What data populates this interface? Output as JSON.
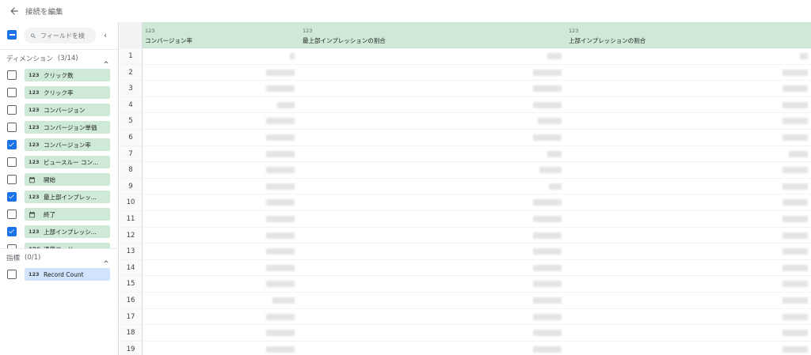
{
  "header": {
    "title": "接続を編集"
  },
  "search": {
    "placeholder": "フィールドを検"
  },
  "dimensions": {
    "title": "ディメンション",
    "count": "(3/14)",
    "fields": [
      {
        "type": "123",
        "label": "クリック数",
        "checked": false
      },
      {
        "type": "123",
        "label": "クリック率",
        "checked": false
      },
      {
        "type": "123",
        "label": "コンバージョン",
        "checked": false
      },
      {
        "type": "123",
        "label": "コンバージョン単価",
        "checked": false
      },
      {
        "type": "123",
        "label": "コンバージョン率",
        "checked": true
      },
      {
        "type": "123",
        "label": "ビュースルー コン...",
        "checked": false
      },
      {
        "type": "calendar",
        "label": "開始",
        "checked": false
      },
      {
        "type": "123",
        "label": "最上部インプレッ...",
        "checked": true
      },
      {
        "type": "calendar",
        "label": "終了",
        "checked": false
      },
      {
        "type": "123",
        "label": "上部インプレッシ...",
        "checked": true
      },
      {
        "type": "ABC",
        "label": "通貨コード",
        "checked": false
      }
    ]
  },
  "metrics": {
    "title": "指標",
    "count": "(0/1)",
    "fields": [
      {
        "type": "123",
        "label": "Record Count",
        "checked": false
      }
    ]
  },
  "table": {
    "columns": [
      {
        "type": "123",
        "name": "コンバージョン率"
      },
      {
        "type": "123",
        "name": "最上部インプレッションの割合"
      },
      {
        "type": "123",
        "name": "上部インプレッションの割合"
      }
    ],
    "row_numbers": [
      "1",
      "2",
      "3",
      "4",
      "5",
      "6",
      "7",
      "8",
      "9",
      "10",
      "11",
      "12",
      "13",
      "14",
      "15",
      "16",
      "17",
      "18",
      "19"
    ]
  }
}
